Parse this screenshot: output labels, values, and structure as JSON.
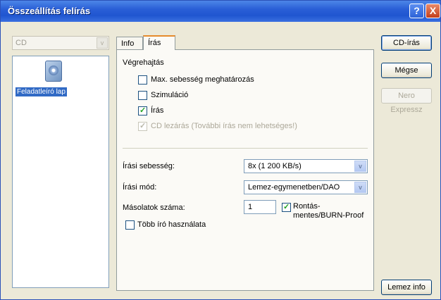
{
  "window": {
    "title": "Összeállítás felírás",
    "help_label": "?",
    "close_label": "X"
  },
  "left": {
    "combo_value": "CD",
    "combo_arrow": "v",
    "item_label": "Feladatleíró lap"
  },
  "tabs": [
    {
      "label": "Info"
    },
    {
      "label": "Írás",
      "active": true
    }
  ],
  "execution": {
    "title": "Végrehajtás",
    "options": [
      {
        "label": "Max. sebesség meghatározás",
        "checked": false,
        "disabled": false
      },
      {
        "label": "Szimuláció",
        "checked": false,
        "disabled": false
      },
      {
        "label": "Írás",
        "checked": true,
        "disabled": false
      },
      {
        "label": "CD lezárás (További írás nem lehetséges!)",
        "checked": true,
        "disabled": true
      }
    ]
  },
  "settings": {
    "speed_label": "Írási sebesség:",
    "speed_value": "8x (1 200 KB/s)",
    "mode_label": "Írási mód:",
    "mode_value": "Lemez-egymenetben/DAO",
    "copies_label": "Másolatok száma:",
    "copies_value": "1",
    "burn_proof_label": "Rontás-mentes/BURN-Proof",
    "burn_proof_checked": true,
    "multi_writer_label": "Több író használata",
    "multi_writer_checked": false
  },
  "buttons": {
    "cd_iras": "CD-írás",
    "megse": "Mégse",
    "nero_express": "Nero Expressz",
    "lemez_info": "Lemez info"
  },
  "colors": {
    "title_bar": "#2a5fd6",
    "selection": "#316ac5",
    "check": "#21a121",
    "active_tab_accent": "#e68b2c"
  }
}
